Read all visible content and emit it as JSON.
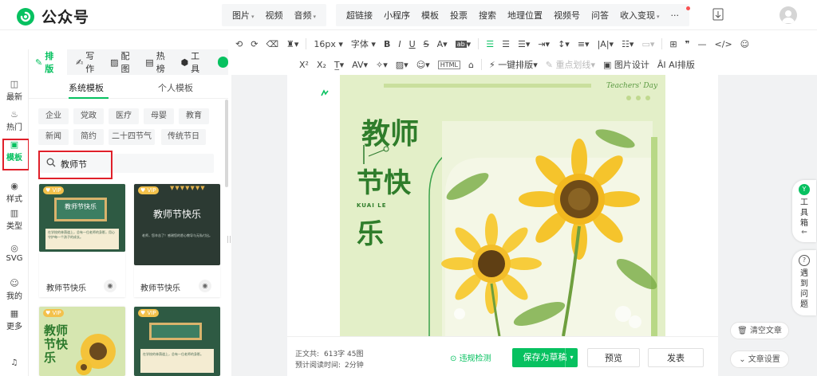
{
  "app": {
    "title": "公众号"
  },
  "topnav": {
    "group1": [
      {
        "label": "图片",
        "caret": true
      },
      {
        "label": "视频",
        "caret": false
      },
      {
        "label": "音频",
        "caret": true
      }
    ],
    "group2": [
      {
        "label": "超链接",
        "caret": false
      },
      {
        "label": "小程序",
        "caret": false
      },
      {
        "label": "模板",
        "caret": false
      },
      {
        "label": "投票",
        "caret": false
      },
      {
        "label": "搜索",
        "caret": false
      },
      {
        "label": "地理位置",
        "caret": false
      },
      {
        "label": "视频号",
        "caret": false
      },
      {
        "label": "问答",
        "caret": false
      },
      {
        "label": "收入变现",
        "caret": true
      },
      {
        "label": "···",
        "caret": false
      }
    ]
  },
  "toolbar": {
    "font_size": "16px",
    "font_family": "字体",
    "one_click_layout": "一键排版",
    "key_underline": "重点划线",
    "image_design": "图片设计",
    "ai_layout": "AI排版"
  },
  "rail": [
    {
      "label": "最新",
      "icon": "latest-icon",
      "glyph": "◫"
    },
    {
      "label": "热门",
      "icon": "fire-icon",
      "glyph": "♨"
    },
    {
      "label": "模板",
      "icon": "template-icon",
      "glyph": "▣"
    },
    {
      "label": "样式",
      "icon": "style-icon",
      "glyph": "◉"
    },
    {
      "label": "类型",
      "icon": "type-icon",
      "glyph": "▥"
    },
    {
      "label": "SVG",
      "icon": "svg-icon",
      "glyph": "◎"
    },
    {
      "label": "我的",
      "icon": "user-icon",
      "glyph": "☺"
    },
    {
      "label": "更多",
      "icon": "more-icon",
      "glyph": "▦"
    }
  ],
  "panel_tabs": [
    {
      "label": "排版",
      "glyph": "✎"
    },
    {
      "label": "写作",
      "glyph": "✍"
    },
    {
      "label": "配图",
      "glyph": "▨"
    },
    {
      "label": "热榜",
      "glyph": "▤"
    },
    {
      "label": "工具",
      "glyph": "⬢"
    }
  ],
  "subtabs": {
    "system": "系统模板",
    "personal": "个人模板"
  },
  "chips": [
    "企业",
    "党政",
    "医疗",
    "母婴",
    "教育",
    "新闻",
    "简约",
    "二十四节气",
    "传统节日"
  ],
  "search": {
    "value": "教师节"
  },
  "cards": [
    {
      "label": "教师节快乐",
      "badge": "VIP",
      "title": "教师节快乐",
      "body": "在学校的林荫道上，总有一位老师的身影，用心守护每一个孩子的成长。"
    },
    {
      "label": "教师节快乐",
      "badge": "VIP",
      "title": "教师节快乐",
      "body": "老师，您辛苦了！感谢您的悉心教导与无私付出。"
    },
    {
      "label": "",
      "badge": "VIP",
      "title": "教师节快乐",
      "body": ""
    },
    {
      "label": "",
      "badge": "VIP",
      "title": "",
      "body": "在学校的林荫道上，总有一位老师的身影。"
    }
  ],
  "poster": {
    "header": "Teachers' Day",
    "line1": "教师",
    "line2": "节快",
    "line3": "乐",
    "pinyin": "KUAI LE"
  },
  "status": {
    "word_count_label": "正文共:",
    "word_count": "613字 45图",
    "read_time_label": "预计阅读时间:",
    "read_time": "2分钟",
    "check": "违规检测",
    "save": "保存为草稿",
    "preview": "预览",
    "publish": "发表"
  },
  "side": {
    "toolbox": "工具箱",
    "help": "遇到问题",
    "clear": "清空文章",
    "settings": "文章设置"
  },
  "colors": {
    "brand": "#07c160",
    "highlight": "#e0202a"
  }
}
